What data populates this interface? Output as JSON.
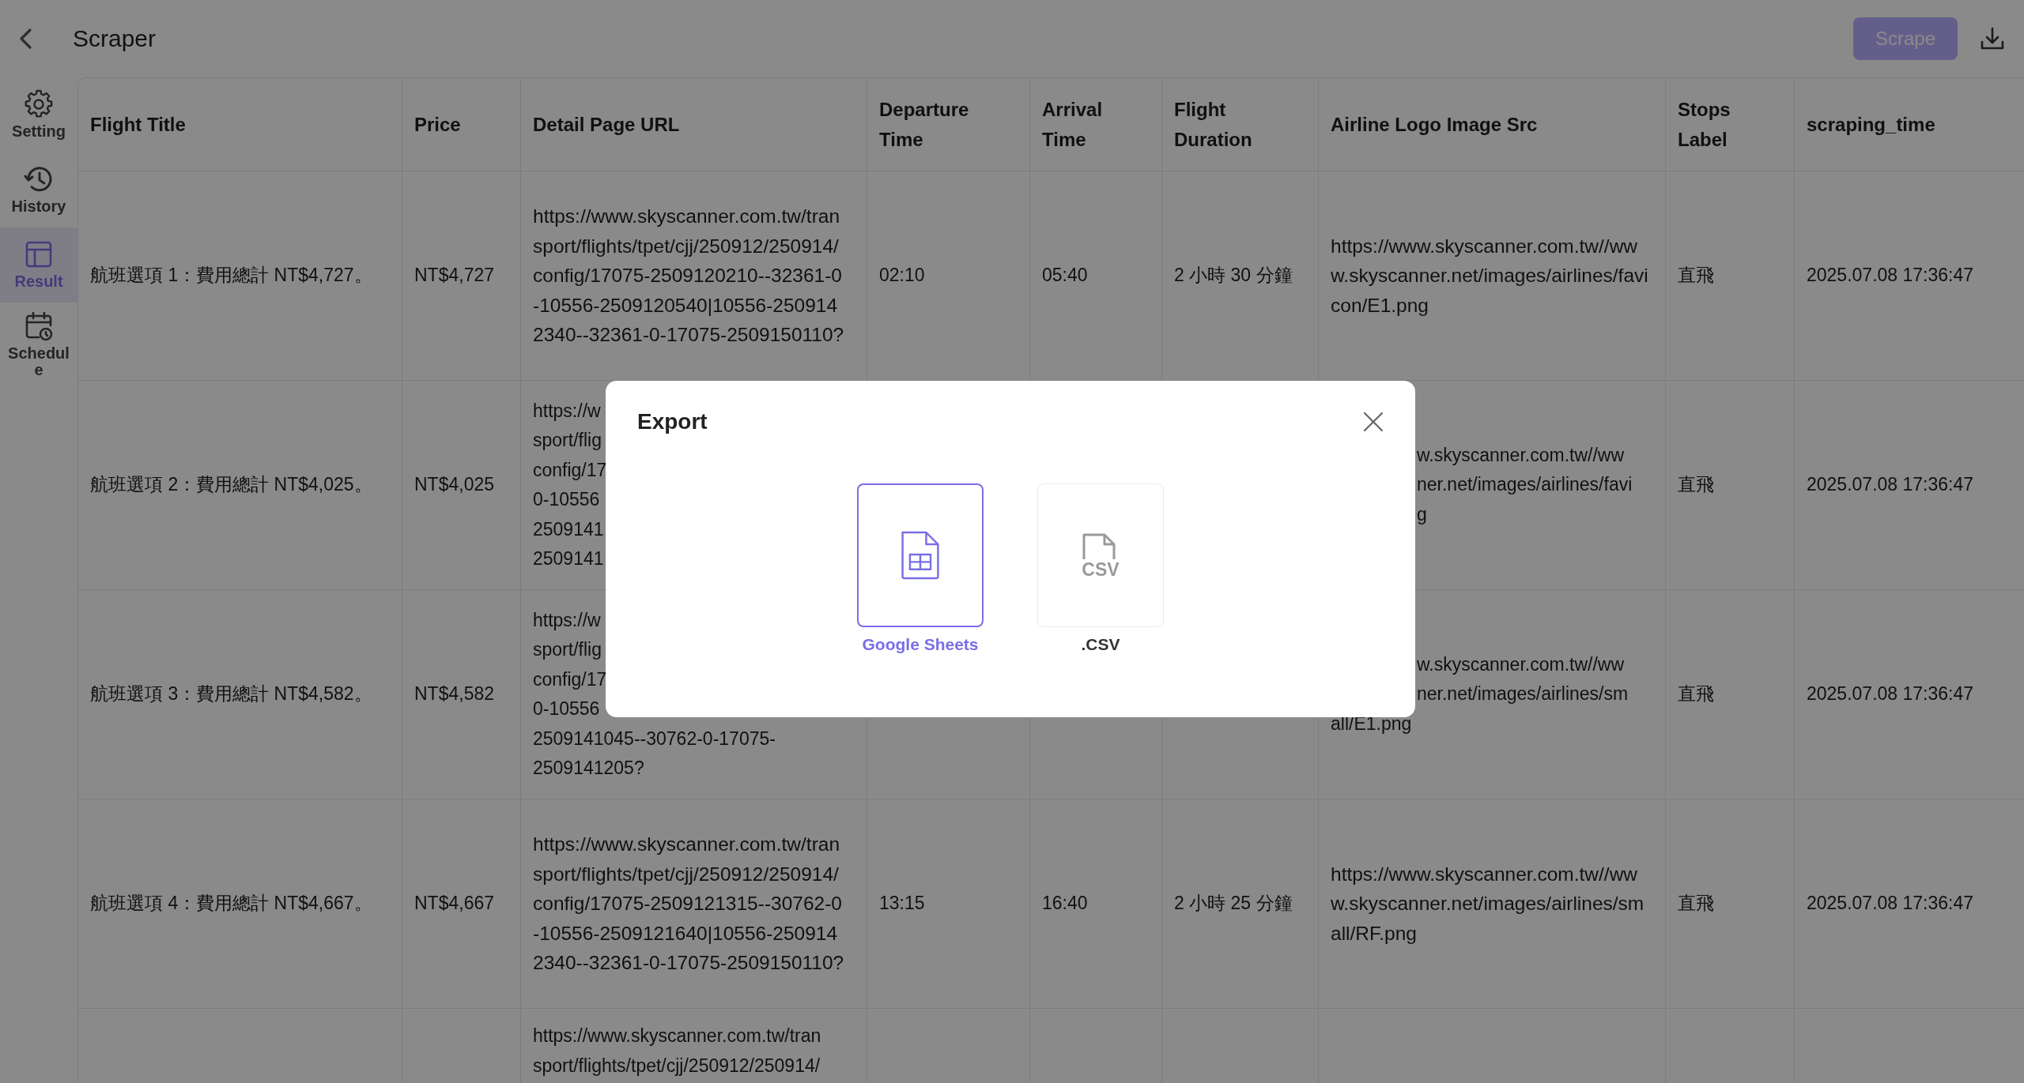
{
  "app_bar": {
    "title": "Scraper",
    "scrape_button": "Scrape"
  },
  "sidebar": {
    "items": [
      {
        "label": "Setting",
        "selected": false
      },
      {
        "label": "History",
        "selected": false
      },
      {
        "label": "Result",
        "selected": true
      },
      {
        "label": "Schedule",
        "selected": false
      }
    ]
  },
  "table": {
    "columns": [
      "Flight Title",
      "Price",
      "Detail Page URL",
      "Departure Time",
      "Arrival Time",
      "Flight Duration",
      "Airline Logo Image Src",
      "Stops Label",
      "scraping_time"
    ],
    "rows": [
      {
        "flight_title": "航班選項 1：費用總計 NT$4,727。",
        "price": "NT$4,727",
        "detail_page_url": "https://www.skyscanner.com.tw/transport/flights/tpet/cjj/250912/250914/config/17075-2509120210--32361-0-10556-2509120540|10556-2509142340--32361-0-17075-2509150110?",
        "departure_time": "02:10",
        "arrival_time": "05:40",
        "flight_duration": "2 小時 30 分鐘",
        "airline_logo_image_src": "https://www.skyscanner.com.tw//www.skyscanner.net/images/airlines/favicon/E1.png",
        "stops_label": "直飛",
        "scraping_time": "2025.07.08 17:36:47"
      },
      {
        "flight_title": "航班選項 2：費用總計 NT$4,025。",
        "price": "NT$4,025",
        "detail_page_url": {
          "lines": [
            {
              "text": "https://w",
              "cut_left": false
            },
            {
              "text": "sport/flig",
              "cut_left": false
            },
            {
              "text": "config/17",
              "cut_left": false
            },
            {
              "text": "0-10556",
              "cut_left": false
            },
            {
              "text": "2509141",
              "cut_left": false
            },
            {
              "text": "2509141",
              "cut_left": false
            }
          ]
        },
        "airline_logo_image_src": {
          "lines": [
            {
              "text": "w.skyscanner.com.tw//ww",
              "cut_left": true
            },
            {
              "text": "ner.net/images/airlines/favi",
              "cut_left": true
            },
            {
              "text": "g",
              "cut_left": true
            }
          ]
        },
        "stops_label": "直飛",
        "scraping_time": "2025.07.08 17:36:47"
      },
      {
        "flight_title": "航班選項 3：費用總計 NT$4,582。",
        "price": "NT$4,582",
        "detail_page_url": {
          "lines": [
            {
              "text": "https://w",
              "cut_left": false
            },
            {
              "text": "sport/flig",
              "cut_left": false
            },
            {
              "text": "config/17",
              "cut_left": false
            },
            {
              "text": "0-10556",
              "cut_left": false
            },
            {
              "text": "2509141045--30762-0-17075-",
              "cut_left": false
            },
            {
              "text": "2509141205?",
              "cut_left": false
            }
          ]
        },
        "airline_logo_image_src": {
          "lines": [
            {
              "text": "w.skyscanner.com.tw//ww",
              "cut_left": true
            },
            {
              "text": "ner.net/images/airlines/sm",
              "cut_left": true
            },
            {
              "text": "all/E1.png",
              "cut_left": false
            }
          ]
        },
        "stops_label": "直飛",
        "scraping_time": "2025.07.08 17:36:47"
      },
      {
        "flight_title": "航班選項 4：費用總計 NT$4,667。",
        "price": "NT$4,667",
        "detail_page_url": "https://www.skyscanner.com.tw/transport/flights/tpet/cjj/250912/250914/config/17075-2509121315--30762-0-10556-2509121640|10556-2509142340--32361-0-17075-2509150110?",
        "departure_time": "13:15",
        "arrival_time": "16:40",
        "flight_duration": "2 小時 25 分鐘",
        "airline_logo_image_src": "https://www.skyscanner.com.tw//www.skyscanner.net/images/airlines/small/RF.png",
        "stops_label": "直飛",
        "scraping_time": "2025.07.08 17:36:47"
      },
      {
        "cut_bottom": true,
        "detail_page_url": {
          "lines": [
            {
              "text": "https://www.skyscanner.com.tw/tran",
              "cut_left": false
            },
            {
              "text": "sport/flights/tpet/cjj/250912/250914/",
              "cut_left": false
            }
          ]
        }
      }
    ]
  },
  "export_dialog": {
    "title": "Export",
    "options": [
      {
        "kind": "sheets",
        "label": "Google Sheets",
        "selected": true
      },
      {
        "kind": "csv",
        "badge": "CSV",
        "label": ".CSV",
        "selected": false
      }
    ]
  }
}
